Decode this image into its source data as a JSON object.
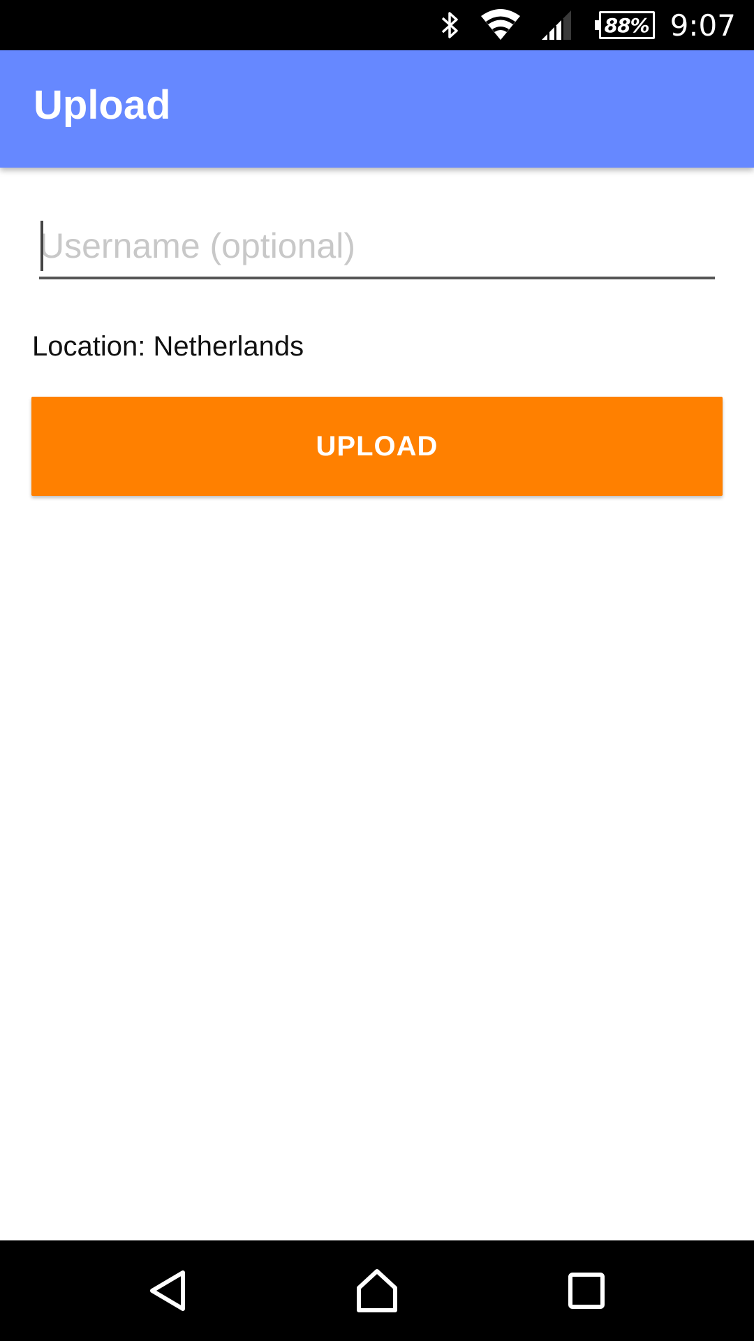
{
  "status_bar": {
    "battery": "88%",
    "time": "9:07",
    "icons": [
      "bluetooth-icon",
      "wifi-icon",
      "cell-signal-icon",
      "battery-icon"
    ]
  },
  "app_bar": {
    "title": "Upload",
    "color": "#6688ff"
  },
  "form": {
    "username": {
      "value": "",
      "placeholder": "Username (optional)"
    },
    "location_text": "Location: Netherlands",
    "upload_button": {
      "label": "UPLOAD",
      "color": "#ff8000"
    }
  },
  "nav_bar": {
    "icons": [
      "back-icon",
      "home-icon",
      "recents-icon"
    ]
  }
}
